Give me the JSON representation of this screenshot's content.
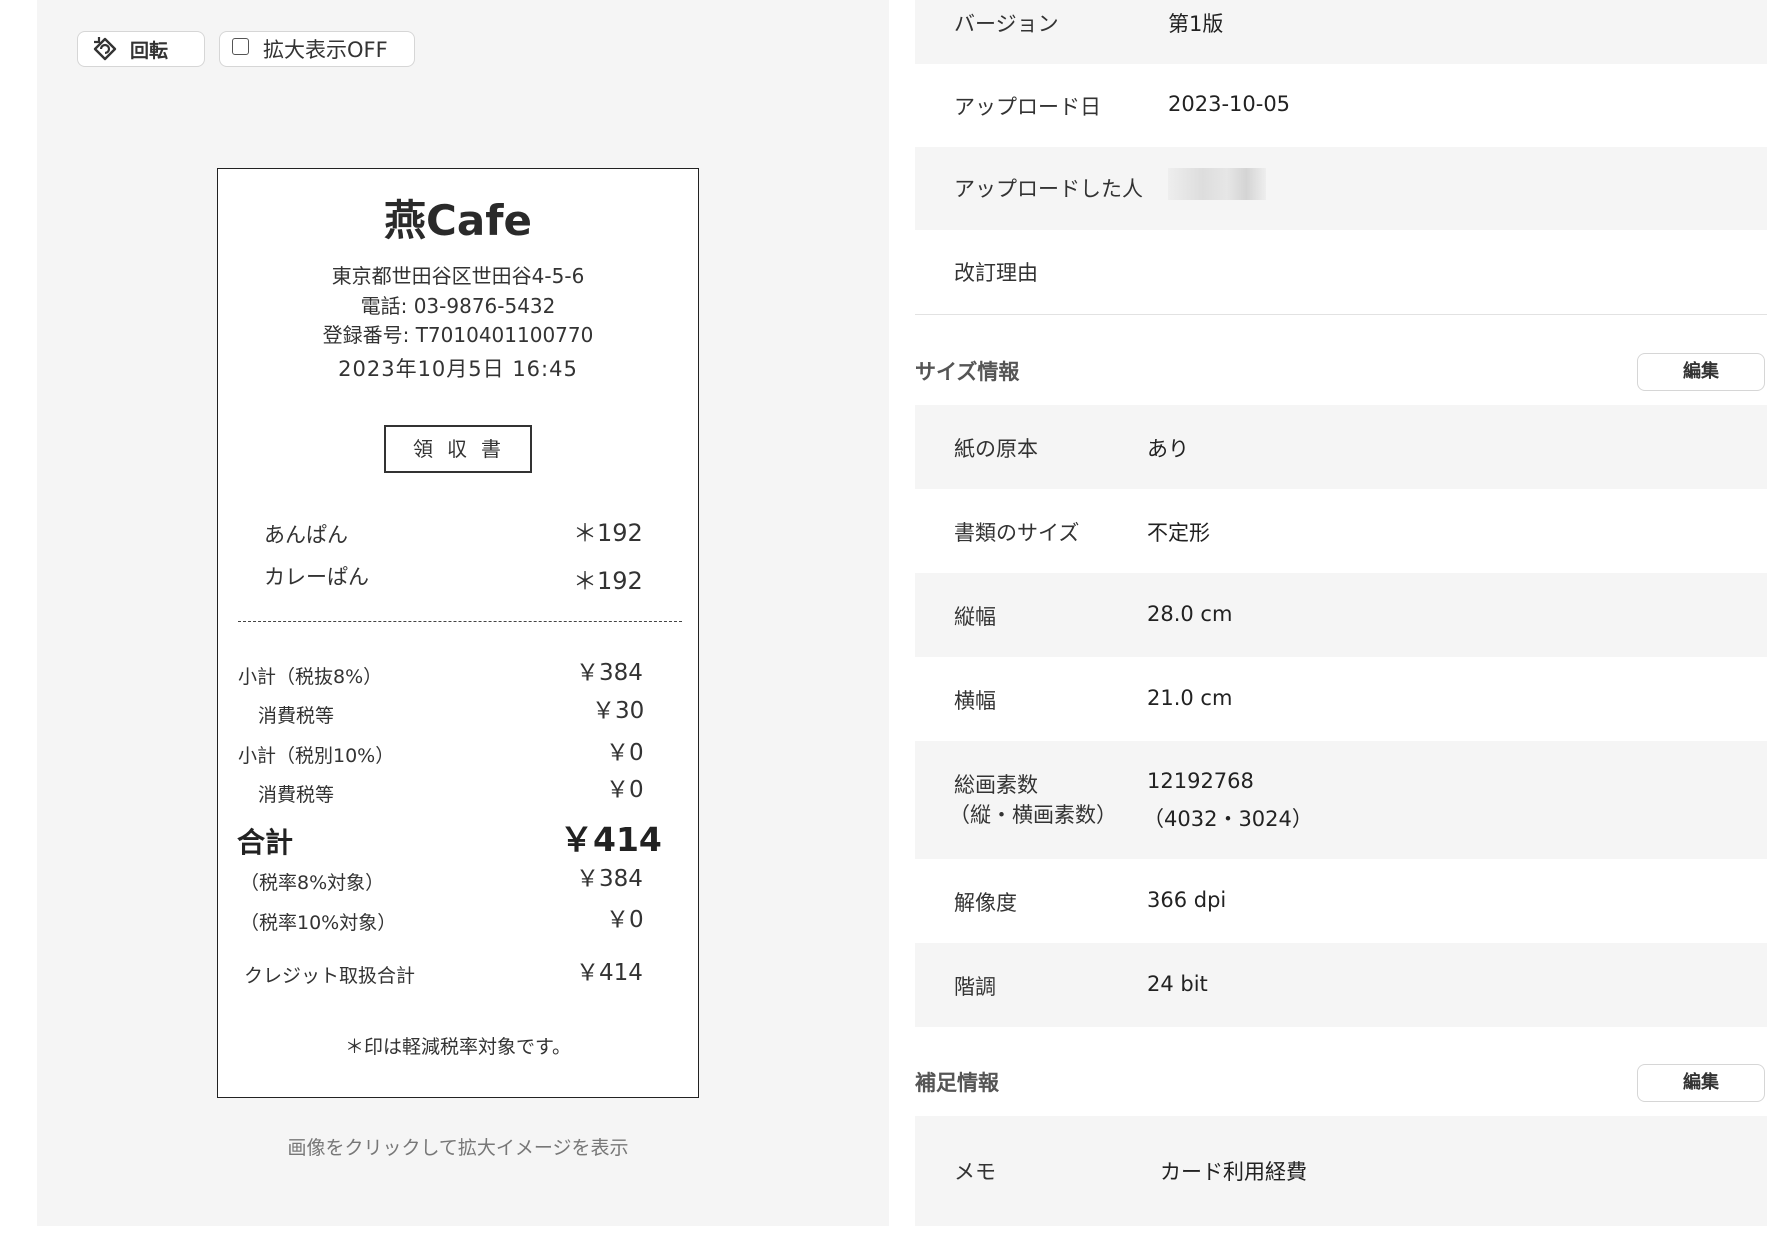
{
  "toolbar": {
    "rotate_label": "回転",
    "zoom_label": "拡大表示OFF"
  },
  "receipt": {
    "store_name": "燕Cafe",
    "address": "東京都世田谷区世田谷4-5-6",
    "phone": "電話: 03-9876-5432",
    "registration": "登録番号: T7010401100770",
    "datetime": "2023年10月5日  16:45",
    "doc_title": "領収書",
    "items": [
      {
        "name": "あんぱん",
        "price": "＊192"
      },
      {
        "name": "カレーぱん",
        "price": "＊192"
      }
    ],
    "subtotal_8_label": "小計（税抜8%）",
    "subtotal_8_value": "￥384",
    "tax_8_label": "消費税等",
    "tax_8_value": "￥30",
    "subtotal_10_label": "小計（税別10%）",
    "subtotal_10_value": "￥0",
    "tax_10_label": "消費税等",
    "tax_10_value": "￥0",
    "total_label": "合計",
    "total_value": "￥414",
    "target_8_label": "（税率8%対象）",
    "target_8_value": "￥384",
    "target_10_label": "（税率10%対象）",
    "target_10_value": "￥0",
    "credit_label": "クレジット取扱合計",
    "credit_value": "￥414",
    "footnote": "＊印は軽減税率対象です。"
  },
  "preview_caption": "画像をクリックして拡大イメージを表示",
  "document_info": {
    "version_label": "バージョン",
    "version_value": "第1版",
    "upload_date_label": "アップロード日",
    "upload_date_value": "2023-10-05",
    "uploader_label": "アップロードした人",
    "revision_reason_label": "改訂理由"
  },
  "size_info": {
    "section_title": "サイズ情報",
    "edit_label": "編集",
    "paper_original_label": "紙の原本",
    "paper_original_value": "あり",
    "doc_size_label": "書類のサイズ",
    "doc_size_value": "不定形",
    "height_label": "縦幅",
    "height_value": "28.0 cm",
    "width_label": "横幅",
    "width_value": "21.0 cm",
    "pixels_label_1": "総画素数",
    "pixels_label_2": "（縦・横画素数）",
    "pixels_value_1": "12192768",
    "pixels_value_2": "（4032・3024）",
    "resolution_label": "解像度",
    "resolution_value": "366 dpi",
    "gradation_label": "階調",
    "gradation_value": "24 bit"
  },
  "supplement_info": {
    "section_title": "補足情報",
    "edit_label": "編集",
    "memo_label": "メモ",
    "memo_value": "カード利用経費"
  }
}
